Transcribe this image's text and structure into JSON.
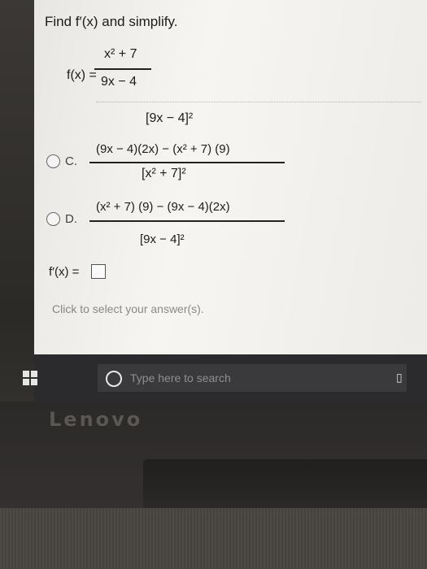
{
  "question": {
    "prompt": "Find f′(x) and simplify.",
    "function_label": "f(x) =",
    "numerator": "x² + 7",
    "denominator": "9x − 4"
  },
  "option_b_partial": {
    "denominator": "[9x − 4]²"
  },
  "option_c": {
    "label": "C.",
    "numerator": "(9x − 4)(2x) − (x² + 7) (9)",
    "denominator": "[x² + 7]²"
  },
  "option_d": {
    "label": "D.",
    "numerator": "(x² + 7) (9) − (9x − 4)(2x)",
    "denominator": "[9x − 4]²"
  },
  "answer": {
    "label": "f′(x) =",
    "value": ""
  },
  "hint": "Click to select your answer(s).",
  "taskbar": {
    "search_placeholder": "Type here to search"
  },
  "brand": "Lenovo"
}
